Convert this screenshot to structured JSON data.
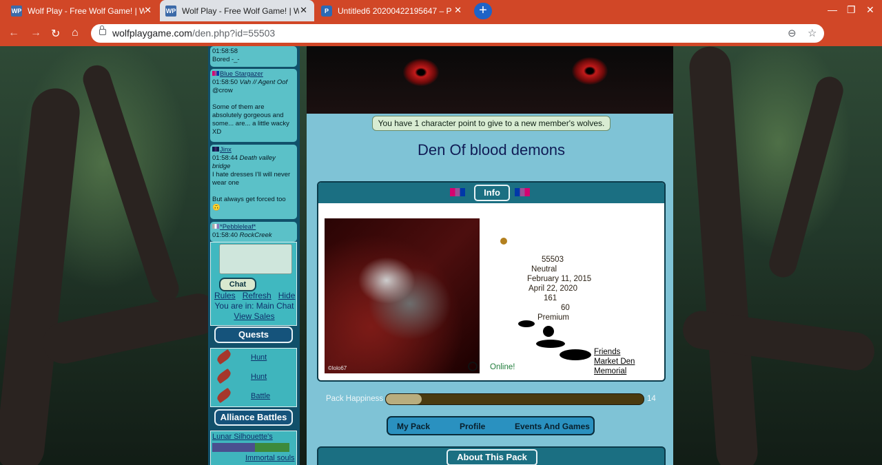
{
  "browser": {
    "tabs": [
      {
        "favicon": "WP",
        "title": "Wolf Play - Free Wolf Game! | W",
        "close": "✕"
      },
      {
        "favicon": "WP",
        "title": "Wolf Play - Free Wolf Game! | W",
        "close": "✕"
      },
      {
        "favicon": "P",
        "title": "Untitled6 20200422195647 – P",
        "close": "✕"
      }
    ],
    "new_tab": "+",
    "window": {
      "minimize": "—",
      "maximize": "❐",
      "close": "✕"
    },
    "url_host": "wolfplaygame.com",
    "url_path": "/den.php?id=55503",
    "nav": {
      "back": "←",
      "forward": "→",
      "reload": "↻",
      "home": "⌂"
    },
    "omni_icons": {
      "zoom": "⊖",
      "star": "☆"
    }
  },
  "chat": {
    "messages": [
      {
        "user": "",
        "time": "01:58:58",
        "location": "",
        "text": "Bored -_-"
      },
      {
        "user": "Blue Stargazer",
        "time": "01:58:50",
        "location": "Vah // Agent Oof",
        "text": "@crow\n\nSome of them are absolutely gorgeous and some... are... a little wacky XD"
      },
      {
        "user": "Jinx",
        "time": "01:58:44",
        "location": "Death valley bridge",
        "text": "I hate dresses I'll will never wear one\n\nBut always get forced too 🙃"
      },
      {
        "user": "*Pebbleleaf*",
        "time": "01:58:40",
        "location": "RockCreek",
        "text": ""
      }
    ],
    "send_label": "Chat",
    "links": [
      "Rules",
      "Refresh",
      "Hide"
    ],
    "location_text": "You are in: Main Chat",
    "view_sales": "View Sales"
  },
  "quests": {
    "title": "Quests",
    "items": [
      "Hunt",
      "Hunt",
      "Battle"
    ]
  },
  "alliance": {
    "title": "Alliance Battles",
    "team": "Lunar Silhouette's",
    "opponent": "Immortal souls"
  },
  "den": {
    "notice": "You have 1 character point to give to a new member's wolves.",
    "name": "Den Of blood demons",
    "info_tab": "Info",
    "image_signature": "©lolo67",
    "details": {
      "id": "55503",
      "alignment": "Neutral",
      "created": "February 11, 2015",
      "last_active": "April 22, 2020",
      "members": "161",
      "level": "60",
      "membership": "Premium"
    },
    "status": "Online!",
    "links": [
      "Friends",
      "Market Den",
      "Memorial"
    ],
    "happiness_label": "Pack Happiness",
    "happiness_value": "14",
    "happiness_fraction": 0.14,
    "nav": [
      "My Pack",
      "Profile",
      "Events And Games"
    ],
    "about_title": "About This Pack"
  },
  "colors": {
    "chrome": "#d14727",
    "sidebar": "#11506a",
    "main": "#7fc3d6",
    "header": "#1b6f82"
  }
}
